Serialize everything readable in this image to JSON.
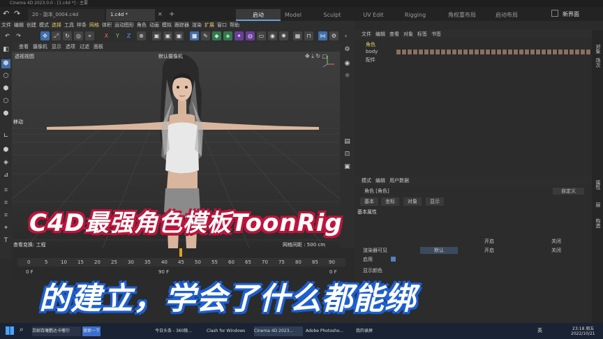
{
  "window": {
    "title": "Cinema 4D 2023.0.0 - [1.c4d *] - 主要"
  },
  "file_tabs": [
    {
      "label": "20 - 副本_0004.c4d"
    },
    {
      "label": "1.c4d *"
    }
  ],
  "layout_tabs": [
    {
      "label": "启动",
      "active": true
    },
    {
      "label": "Model"
    },
    {
      "label": "Sculpt"
    },
    {
      "label": "UV Edit"
    },
    {
      "label": "Rigging"
    },
    {
      "label": "角权重布局"
    },
    {
      "label": "启动布局"
    }
  ],
  "new_interface": "新界面",
  "menu": [
    "文件",
    "编辑",
    "创建",
    "模式",
    "选择",
    "工具",
    "样条",
    "网格",
    "体积",
    "运动图形",
    "角色",
    "动画",
    "模拟",
    "跟踪器",
    "渲染",
    "扩展",
    "窗口",
    "帮助"
  ],
  "toolbar": {
    "axes": [
      "X",
      "Y",
      "Z"
    ]
  },
  "viewport": {
    "menu": [
      "查看",
      "摄像机",
      "显示",
      "选项",
      "过滤",
      "面板"
    ],
    "title": "透视视图",
    "camera": "默认摄像机",
    "move_label": "移动",
    "status_left": "查看变换: 工程",
    "grid_spacing": "网格间距 : 500 cm"
  },
  "timeline": {
    "ticks": [
      "0",
      "5",
      "10",
      "15",
      "20",
      "25",
      "30",
      "35",
      "40",
      "45",
      "50",
      "55",
      "60",
      "65",
      "70",
      "75",
      "80",
      "85",
      "90"
    ],
    "start": "0 F",
    "end": "0 F",
    "right_end": "90 F"
  },
  "object_manager": {
    "menu": [
      "文件",
      "编辑",
      "查看",
      "对象",
      "标签",
      "书签"
    ],
    "items": [
      {
        "name": "角色"
      },
      {
        "name": "body"
      },
      {
        "name": "配件"
      }
    ]
  },
  "attribute_manager": {
    "menu": [
      "模式",
      "编辑",
      "用户数据"
    ],
    "object": "角色 [角色]",
    "preset": "自定义",
    "tabs": [
      "基本",
      "坐标",
      "对象",
      "显示"
    ],
    "section": "基本属性",
    "rows": [
      {
        "label": "渲染器可见",
        "values": [
          "默认",
          "开启",
          "关闭"
        ]
      },
      {
        "label": "启用"
      },
      {
        "label": "显示颜色"
      }
    ],
    "row_top_values": [
      "开启",
      "关闭"
    ]
  },
  "side_tabs": {
    "right": [
      "对象",
      "场次",
      "属性",
      "层",
      "构造"
    ]
  },
  "overlay": {
    "title": "C4D最强角色模板ToonRig",
    "subtitle": "的建立，学会了什么都能绑"
  },
  "taskbar": {
    "items": [
      "京剧百庵氍达卡嘟尔",
      "搜索一下",
      "今日头条 - 360极...",
      "Clash for Windows",
      "Cinema 4D 2023...",
      "Adobe Photosho...",
      "我的录屏"
    ],
    "time": "23:18 周五",
    "date": "2022/10/21",
    "ime": "英"
  }
}
